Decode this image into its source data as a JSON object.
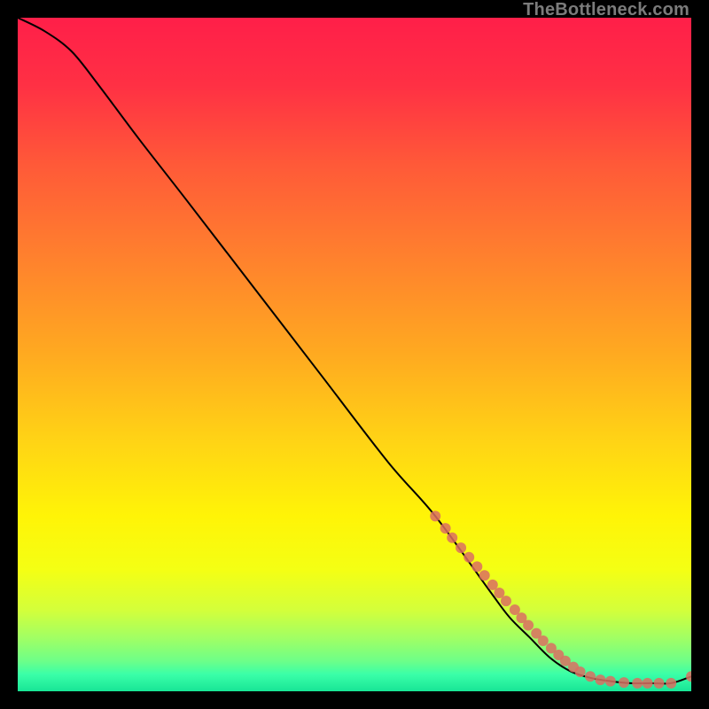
{
  "watermark": "TheBottleneck.com",
  "gradient_stops": [
    {
      "offset": 0.0,
      "color": "#ff1f49"
    },
    {
      "offset": 0.1,
      "color": "#ff3044"
    },
    {
      "offset": 0.22,
      "color": "#ff5a38"
    },
    {
      "offset": 0.35,
      "color": "#ff7f2e"
    },
    {
      "offset": 0.5,
      "color": "#ffaa20"
    },
    {
      "offset": 0.63,
      "color": "#ffd415"
    },
    {
      "offset": 0.74,
      "color": "#fff407"
    },
    {
      "offset": 0.82,
      "color": "#f4ff14"
    },
    {
      "offset": 0.88,
      "color": "#d3ff3b"
    },
    {
      "offset": 0.92,
      "color": "#a2ff63"
    },
    {
      "offset": 0.955,
      "color": "#6dff88"
    },
    {
      "offset": 0.975,
      "color": "#3affa8"
    },
    {
      "offset": 1.0,
      "color": "#18e596"
    }
  ],
  "chart_data": {
    "type": "line",
    "title": "",
    "xlabel": "",
    "ylabel": "",
    "xlim": [
      0,
      100
    ],
    "ylim": [
      0,
      100
    ],
    "series": [
      {
        "name": "bottleneck-curve",
        "x": [
          0,
          4,
          8,
          12,
          18,
          25,
          35,
          45,
          55,
          62,
          70,
          73,
          76,
          79,
          82,
          85,
          88,
          91,
          94,
          97,
          100
        ],
        "y": [
          100,
          98,
          95,
          90,
          82,
          73,
          60,
          47,
          34,
          26,
          15,
          11,
          8,
          5,
          3,
          2,
          1.5,
          1.2,
          1.2,
          1.2,
          2.2
        ]
      }
    ],
    "scatter": {
      "name": "sample-points",
      "color": "#da6e62",
      "x": [
        62,
        63.5,
        64.5,
        65.8,
        67,
        68.2,
        69.3,
        70.5,
        71.5,
        72.5,
        73.8,
        74.8,
        75.8,
        77,
        78,
        79.2,
        80.3,
        81.3,
        82.5,
        83.5,
        85,
        86.5,
        88,
        90,
        92,
        93.5,
        95.2,
        97,
        100
      ],
      "y": [
        26,
        24.2,
        22.8,
        21.3,
        19.9,
        18.5,
        17.2,
        15.8,
        14.6,
        13.4,
        12.1,
        10.9,
        9.8,
        8.6,
        7.5,
        6.4,
        5.4,
        4.5,
        3.6,
        2.9,
        2.2,
        1.7,
        1.5,
        1.3,
        1.2,
        1.2,
        1.2,
        1.2,
        2.2
      ]
    }
  }
}
